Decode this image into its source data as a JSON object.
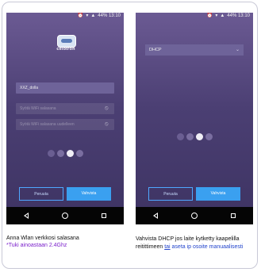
{
  "screens": [
    {
      "status": {
        "text": "44% 13:10",
        "icons": [
          "alarm-icon",
          "wifi-icon",
          "signal-icon",
          "battery-icon"
        ]
      },
      "logo": {
        "brand": "celotron"
      },
      "ssid_value": "XXZ_dolla",
      "password_placeholder": "Syötä WiFi salasana",
      "password_confirm_placeholder": "Syötä WiFi salasana uudelleen",
      "buttons": {
        "cancel": "Peruuta",
        "confirm": "Vahvista"
      }
    },
    {
      "status": {
        "text": "44% 13:10",
        "icons": [
          "alarm-icon",
          "wifi-icon",
          "signal-icon",
          "battery-icon"
        ]
      },
      "mode_select": {
        "value": "DHCP"
      },
      "buttons": {
        "cancel": "Peruuta",
        "confirm": "Vahvista"
      }
    }
  ],
  "captions": {
    "left": {
      "line1": "Anna Wlan verkkosi salasana",
      "note": "*Tuki ainoastaan 2.4Ghz"
    },
    "right": {
      "part1": "Vahvista  DHCP jos laite kytketty kaapelilla reitittimeen ",
      "link": "tai",
      "part2": " aseta ip osoite manuaalisesti"
    }
  },
  "colors": {
    "accent": "#3aa0f0",
    "background_top": "#6b5a93",
    "background_bottom": "#3d3362",
    "note": "#7a1ecb"
  }
}
